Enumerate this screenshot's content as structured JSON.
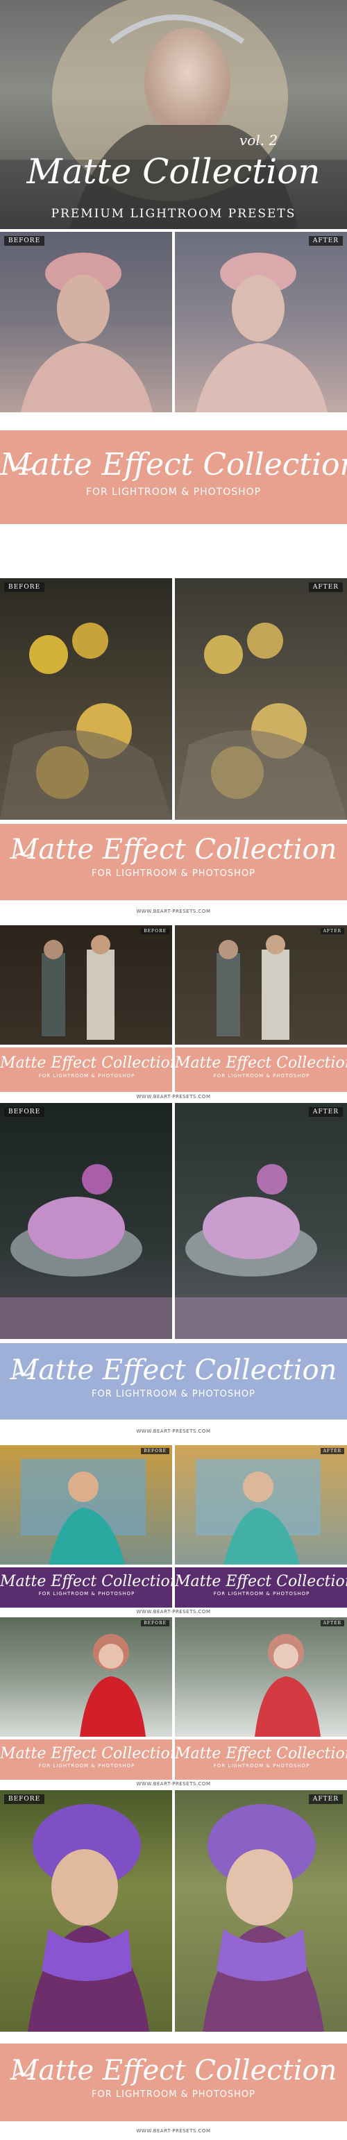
{
  "header": {
    "vol": "vol. 2",
    "title": "Matte Collection",
    "subtitle": "PREMIUM LIGHTROOM PRESETS"
  },
  "labels": {
    "before": "BEFORE",
    "after": "AFTER"
  },
  "banner": {
    "title": "Matte Effect Collection",
    "sub": "FOR LIGHTROOM & PHOTOSHOP",
    "url": "WWW.BEART-PRESETS.COM"
  },
  "colors": {
    "pink_banner": "#e8a08f",
    "blue_banner": "#9fb0d8",
    "purple_banner": "#5a2d6e",
    "label_bg": "#222222"
  }
}
